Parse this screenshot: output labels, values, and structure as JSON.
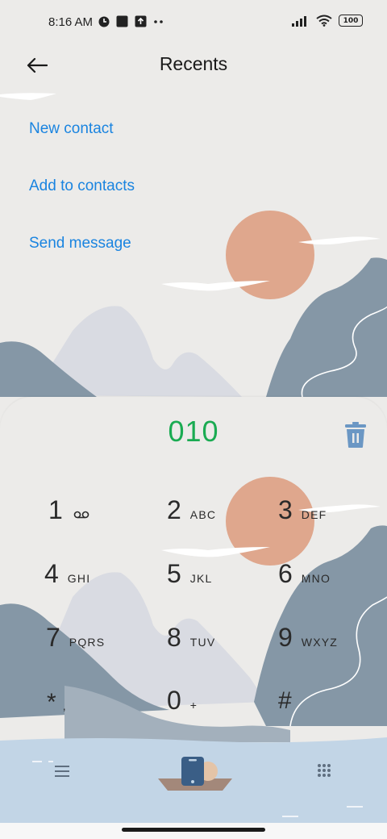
{
  "status_bar": {
    "time": "8:16 AM",
    "battery": "100",
    "icons_left": [
      "app-notification-icon",
      "square-notification-icon",
      "upload-notification-icon",
      "more-dots-icon"
    ],
    "icons_right": [
      "signal-icon",
      "wifi-icon",
      "battery-icon"
    ]
  },
  "header": {
    "title": "Recents",
    "back_icon": "arrow-left-icon"
  },
  "actions": {
    "new_contact": "New contact",
    "add_to_contacts": "Add to contacts",
    "send_message": "Send message"
  },
  "dialer": {
    "number": "010",
    "number_color": "#1aab52",
    "delete_icon": "trash-icon",
    "keys": [
      {
        "digit": "1",
        "letters": "",
        "extra_icon": "voicemail-icon"
      },
      {
        "digit": "2",
        "letters": "ABC"
      },
      {
        "digit": "3",
        "letters": "DEF"
      },
      {
        "digit": "4",
        "letters": "GHI"
      },
      {
        "digit": "5",
        "letters": "JKL"
      },
      {
        "digit": "6",
        "letters": "MNO"
      },
      {
        "digit": "7",
        "letters": "PQRS"
      },
      {
        "digit": "8",
        "letters": "TUV"
      },
      {
        "digit": "9",
        "letters": "WXYZ"
      },
      {
        "digit": "*",
        "letters": ","
      },
      {
        "digit": "0",
        "letters": "+"
      },
      {
        "digit": "#",
        "letters": ""
      }
    ]
  },
  "bottom_bar": {
    "left_icon": "menu-icon",
    "center_icon": "phone-call-icon",
    "right_icon": "dialpad-icon"
  },
  "colors": {
    "accent_link": "#1a84e0",
    "sun": "#dfa78d",
    "mountain_dark": "#8597a6",
    "mountain_light": "#d9dbe2",
    "water": "#c2d5e6"
  }
}
